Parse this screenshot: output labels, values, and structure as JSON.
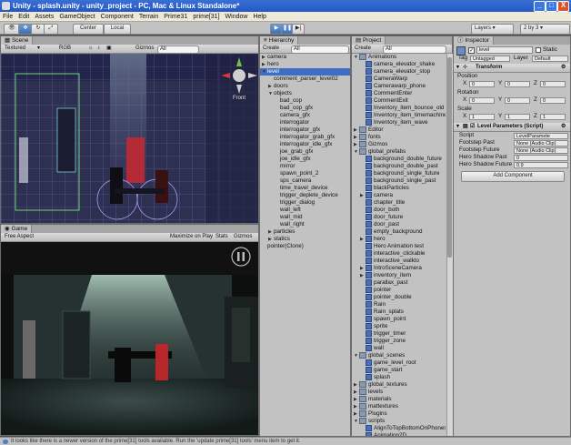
{
  "window": {
    "title": "Unity - splash.unity - unity_project - PC, Mac & Linux Standalone*",
    "min": "_",
    "max": "□",
    "close": "X"
  },
  "menu": [
    "File",
    "Edit",
    "Assets",
    "GameObject",
    "Component",
    "Terrain",
    "Prime31",
    "prime[31]",
    "Window",
    "Help"
  ],
  "toolbar": {
    "center": "Center",
    "local": "Local",
    "layers": "Layers",
    "layout": "2 by 3"
  },
  "scene": {
    "tab": "Scene",
    "textured": "Textured",
    "rgb": "RGB",
    "gizmos": "Gizmos",
    "search": "All",
    "front": "Front"
  },
  "game": {
    "tab": "Game",
    "aspect": "Free Aspect",
    "maximize": "Maximize on Play",
    "stats": "Stats",
    "gizmos": "Gizmos"
  },
  "hierarchy": {
    "tab": "Hierarchy",
    "create": "Create",
    "search": "All",
    "items": [
      {
        "t": "camera",
        "d": 0,
        "a": "c"
      },
      {
        "t": "hero",
        "d": 0,
        "a": "c"
      },
      {
        "t": "level",
        "d": 0,
        "a": "o",
        "sel": true
      },
      {
        "t": "comment_parser_level02",
        "d": 1,
        "a": ""
      },
      {
        "t": "doors",
        "d": 1,
        "a": "c"
      },
      {
        "t": "objects",
        "d": 1,
        "a": "o"
      },
      {
        "t": "bad_cop",
        "d": 2,
        "a": ""
      },
      {
        "t": "bad_cop_gfx",
        "d": 2,
        "a": ""
      },
      {
        "t": "camera_gfx",
        "d": 2,
        "a": ""
      },
      {
        "t": "interrogator",
        "d": 2,
        "a": ""
      },
      {
        "t": "interrogator_gfx",
        "d": 2,
        "a": ""
      },
      {
        "t": "interrogator_grab_gfx",
        "d": 2,
        "a": ""
      },
      {
        "t": "interrogator_idle_gfx",
        "d": 2,
        "a": ""
      },
      {
        "t": "joe_grab_gfx",
        "d": 2,
        "a": ""
      },
      {
        "t": "joe_idle_gfx",
        "d": 2,
        "a": ""
      },
      {
        "t": "mirror",
        "d": 2,
        "a": ""
      },
      {
        "t": "spawn_point_2",
        "d": 2,
        "a": ""
      },
      {
        "t": "sps_camera",
        "d": 2,
        "a": ""
      },
      {
        "t": "time_travel_device",
        "d": 2,
        "a": ""
      },
      {
        "t": "trigger_deplete_device",
        "d": 2,
        "a": ""
      },
      {
        "t": "trigger_dialog",
        "d": 2,
        "a": ""
      },
      {
        "t": "wall_left",
        "d": 2,
        "a": ""
      },
      {
        "t": "wall_mid",
        "d": 2,
        "a": ""
      },
      {
        "t": "wall_right",
        "d": 2,
        "a": ""
      },
      {
        "t": "particles",
        "d": 1,
        "a": "c"
      },
      {
        "t": "statics",
        "d": 1,
        "a": "c"
      },
      {
        "t": "pointer(Clone)",
        "d": 0,
        "a": ""
      }
    ]
  },
  "project": {
    "tab": "Project",
    "create": "Create",
    "search": "All",
    "items": [
      {
        "t": "Animations",
        "d": 0,
        "k": "f",
        "a": "o"
      },
      {
        "t": "camera_elevator_shake",
        "d": 1,
        "k": "p"
      },
      {
        "t": "camera_elevator_stop",
        "d": 1,
        "k": "p"
      },
      {
        "t": "CameraWarp",
        "d": 1,
        "k": "p"
      },
      {
        "t": "Camerawarp_phone",
        "d": 1,
        "k": "p"
      },
      {
        "t": "CommentEnter",
        "d": 1,
        "k": "p"
      },
      {
        "t": "CommentExit",
        "d": 1,
        "k": "p"
      },
      {
        "t": "Inventory_item_bounce_old",
        "d": 1,
        "k": "p"
      },
      {
        "t": "Inventory_item_timemachine",
        "d": 1,
        "k": "p"
      },
      {
        "t": "Inventory_item_wave",
        "d": 1,
        "k": "p"
      },
      {
        "t": "Editor",
        "d": 0,
        "k": "f",
        "a": "c"
      },
      {
        "t": "fonts",
        "d": 0,
        "k": "f",
        "a": "c"
      },
      {
        "t": "Gizmos",
        "d": 0,
        "k": "f",
        "a": "c"
      },
      {
        "t": "global_prefabs",
        "d": 0,
        "k": "f",
        "a": "o"
      },
      {
        "t": "background_double_future",
        "d": 1,
        "k": "p"
      },
      {
        "t": "background_double_past",
        "d": 1,
        "k": "p"
      },
      {
        "t": "background_single_future",
        "d": 1,
        "k": "p"
      },
      {
        "t": "background_single_past",
        "d": 1,
        "k": "p"
      },
      {
        "t": "blackParticles",
        "d": 1,
        "k": "p"
      },
      {
        "t": "camera",
        "d": 1,
        "k": "p",
        "a": "c"
      },
      {
        "t": "chapter_title",
        "d": 1,
        "k": "p"
      },
      {
        "t": "door_both",
        "d": 1,
        "k": "p"
      },
      {
        "t": "door_future",
        "d": 1,
        "k": "p"
      },
      {
        "t": "door_past",
        "d": 1,
        "k": "p"
      },
      {
        "t": "empty_background",
        "d": 1,
        "k": "p"
      },
      {
        "t": "hero",
        "d": 1,
        "k": "p",
        "a": "c"
      },
      {
        "t": "Hero Animation test",
        "d": 1,
        "k": "p"
      },
      {
        "t": "interactive_clickable",
        "d": 1,
        "k": "p"
      },
      {
        "t": "interactive_walkto",
        "d": 1,
        "k": "p"
      },
      {
        "t": "IntroSceneCamera",
        "d": 1,
        "k": "p",
        "a": "c"
      },
      {
        "t": "inventory_item",
        "d": 1,
        "k": "p",
        "a": "c"
      },
      {
        "t": "parallax_past",
        "d": 1,
        "k": "p"
      },
      {
        "t": "pointer",
        "d": 1,
        "k": "p"
      },
      {
        "t": "pointer_double",
        "d": 1,
        "k": "p"
      },
      {
        "t": "Rain",
        "d": 1,
        "k": "p"
      },
      {
        "t": "Rain_splats",
        "d": 1,
        "k": "p"
      },
      {
        "t": "spawn_point",
        "d": 1,
        "k": "p"
      },
      {
        "t": "sprite",
        "d": 1,
        "k": "p"
      },
      {
        "t": "trigger_timer",
        "d": 1,
        "k": "p"
      },
      {
        "t": "trigger_zone",
        "d": 1,
        "k": "p"
      },
      {
        "t": "wall",
        "d": 1,
        "k": "p"
      },
      {
        "t": "global_scenes",
        "d": 0,
        "k": "f",
        "a": "o"
      },
      {
        "t": "game_level_root",
        "d": 1,
        "k": "p"
      },
      {
        "t": "game_start",
        "d": 1,
        "k": "p"
      },
      {
        "t": "splash",
        "d": 1,
        "k": "p"
      },
      {
        "t": "global_textures",
        "d": 0,
        "k": "f",
        "a": "c"
      },
      {
        "t": "levels",
        "d": 0,
        "k": "f",
        "a": "c"
      },
      {
        "t": "materials",
        "d": 0,
        "k": "f",
        "a": "c"
      },
      {
        "t": "mattextures",
        "d": 0,
        "k": "f",
        "a": "c"
      },
      {
        "t": "Plugins",
        "d": 0,
        "k": "f",
        "a": "c"
      },
      {
        "t": "scripts",
        "d": 0,
        "k": "f",
        "a": "o"
      },
      {
        "t": "AlignToTopBottomOnPhones",
        "d": 1,
        "k": "p"
      },
      {
        "t": "Animation2D",
        "d": 1,
        "k": "p"
      },
      {
        "t": "AudioController",
        "d": 1,
        "k": "p"
      }
    ]
  },
  "inspector": {
    "tab": "Inspector",
    "name": "level",
    "static": "Static",
    "tag_label": "Tag",
    "tag": "Untagged",
    "layer_label": "Layer",
    "layer": "Default",
    "transform": {
      "title": "Transform",
      "position": {
        "label": "Position",
        "x": "0",
        "y": "0",
        "z": "0"
      },
      "rotation": {
        "label": "Rotation",
        "x": "0",
        "y": "0",
        "z": "0"
      },
      "scale": {
        "label": "Scale",
        "x": "1",
        "y": "1",
        "z": "1"
      }
    },
    "params": {
      "title": "Level Parameters (Script)",
      "rows": [
        {
          "label": "Script",
          "value": "LevelParamete"
        },
        {
          "label": "Footstep Past",
          "value": "None (Audio Clip)"
        },
        {
          "label": "Footstep Future",
          "value": "None (Audio Clip)"
        },
        {
          "label": "Hero Shadow Past",
          "value": "0"
        },
        {
          "label": "Hero Shadow Future",
          "value": "0.9"
        }
      ]
    },
    "add_component": "Add Component"
  },
  "status": "It looks like there is a newer version of the prime[31] tools available. Run the 'update prime[31] tools' menu item to get it."
}
